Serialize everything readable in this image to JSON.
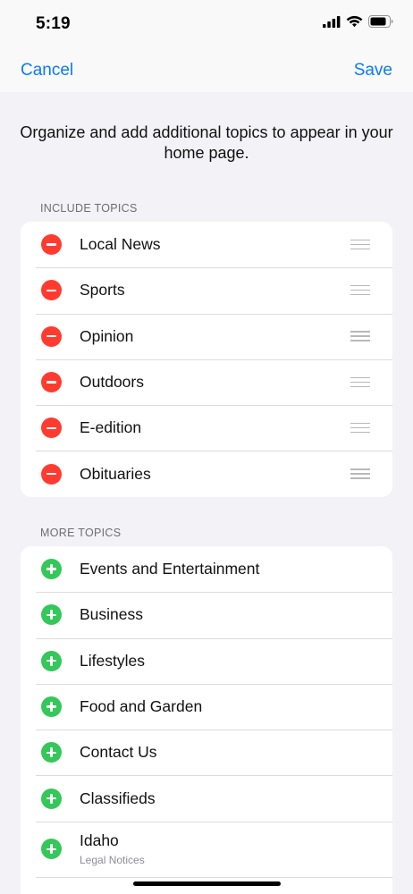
{
  "status_bar": {
    "time": "5:19",
    "icons": [
      "cellular-signal-icon",
      "wifi-icon",
      "battery-icon"
    ]
  },
  "nav": {
    "cancel_label": "Cancel",
    "save_label": "Save"
  },
  "intro_text": "Organize and add additional topics to appear in your home page.",
  "include_section": {
    "header": "INCLUDE TOPICS",
    "items": [
      {
        "label": "Local News"
      },
      {
        "label": "Sports"
      },
      {
        "label": "Opinion"
      },
      {
        "label": "Outdoors"
      },
      {
        "label": "E-edition"
      },
      {
        "label": "Obituaries"
      }
    ]
  },
  "more_section": {
    "header": "MORE TOPICS",
    "items": [
      {
        "label": "Events and Entertainment"
      },
      {
        "label": "Business"
      },
      {
        "label": "Lifestyles"
      },
      {
        "label": "Food and Garden"
      },
      {
        "label": "Contact Us"
      },
      {
        "label": "Classifieds"
      },
      {
        "label": "Idaho",
        "sublabel": "Legal Notices"
      }
    ]
  },
  "colors": {
    "accent": "#0a7aff",
    "remove": "#ff3b30",
    "add": "#34c759",
    "background": "#f2f2f7"
  }
}
